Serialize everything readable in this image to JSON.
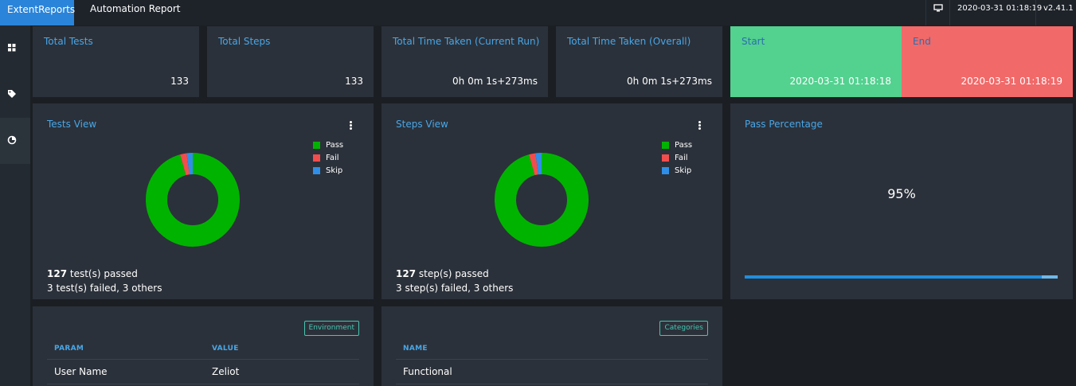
{
  "app": {
    "brand": "ExtentReports",
    "title": "Automation Report",
    "datetime": "2020-03-31 01:18:19",
    "version": "v2.41.1"
  },
  "sidebar": {
    "items": [
      {
        "icon": "dashboard-icon"
      },
      {
        "icon": "tag-icon"
      },
      {
        "icon": "analytics-icon"
      }
    ]
  },
  "kpis": [
    {
      "title": "Total Tests",
      "value": "133"
    },
    {
      "title": "Total Steps",
      "value": "133"
    },
    {
      "title": "Total Time Taken (Current Run)",
      "value": "0h 0m 1s+273ms"
    },
    {
      "title": "Total Time Taken (Overall)",
      "value": "0h 0m 1s+273ms"
    },
    {
      "title": "Start",
      "value": "2020-03-31 01:18:18"
    },
    {
      "title": "End",
      "value": "2020-03-31 01:18:19"
    }
  ],
  "tests_view": {
    "title": "Tests View",
    "passed_count": "127",
    "passed_text": " test(s) passed",
    "others_text": "3 test(s) failed, 3 others"
  },
  "steps_view": {
    "title": "Steps View",
    "passed_count": "127",
    "passed_text": " step(s) passed",
    "others_text": "3 step(s) failed, 3 others"
  },
  "legend": [
    {
      "label": "Pass",
      "color": "#00b300"
    },
    {
      "label": "Fail",
      "color": "#f24d4d"
    },
    {
      "label": "Skip",
      "color": "#2f8fe8"
    }
  ],
  "pass_percentage": {
    "title": "Pass Percentage",
    "value": "95%",
    "fraction": 0.95
  },
  "environment": {
    "button": "Environment",
    "headers": [
      "PARAM",
      "VALUE"
    ],
    "rows": [
      {
        "param": "User Name",
        "value": "Zeliot"
      }
    ]
  },
  "categories": {
    "button": "Categories",
    "headers": [
      "NAME"
    ],
    "rows": [
      {
        "name": "Functional"
      }
    ]
  },
  "chart_data": [
    {
      "type": "pie",
      "title": "Tests View",
      "categories": [
        "Pass",
        "Fail",
        "Skip"
      ],
      "values": [
        127,
        3,
        3
      ]
    },
    {
      "type": "pie",
      "title": "Steps View",
      "categories": [
        "Pass",
        "Fail",
        "Skip"
      ],
      "values": [
        127,
        3,
        3
      ]
    }
  ]
}
